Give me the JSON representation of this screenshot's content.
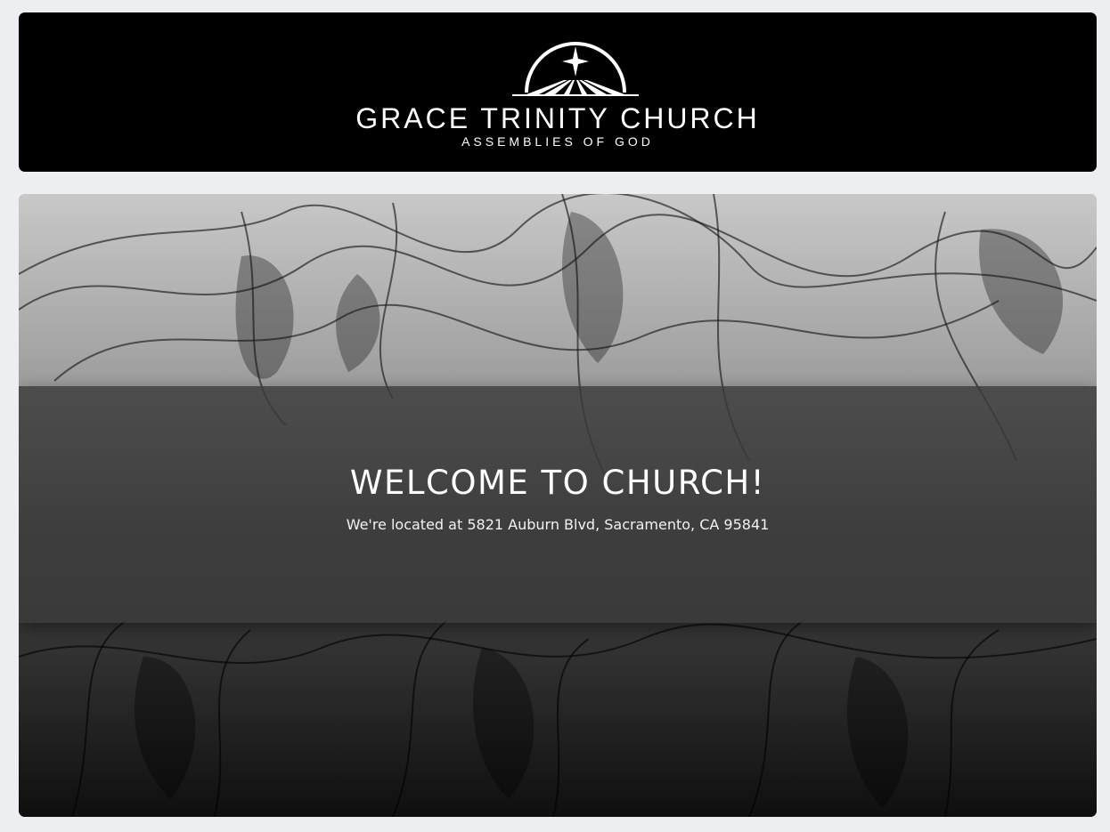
{
  "header": {
    "church_name": "GRACE TRINITY CHURCH",
    "denomination": "ASSEMBLIES OF GOD",
    "logo_icon": "star-over-horizon-icon"
  },
  "hero": {
    "title": "WELCOME TO CHURCH!",
    "address": "We're located at 5821 Auburn Blvd, Sacramento, CA 95841"
  },
  "colors": {
    "page_background": "#eceef1",
    "header_background": "#000000",
    "text": "#ffffff",
    "band_overlay": "#3a3a3a"
  }
}
